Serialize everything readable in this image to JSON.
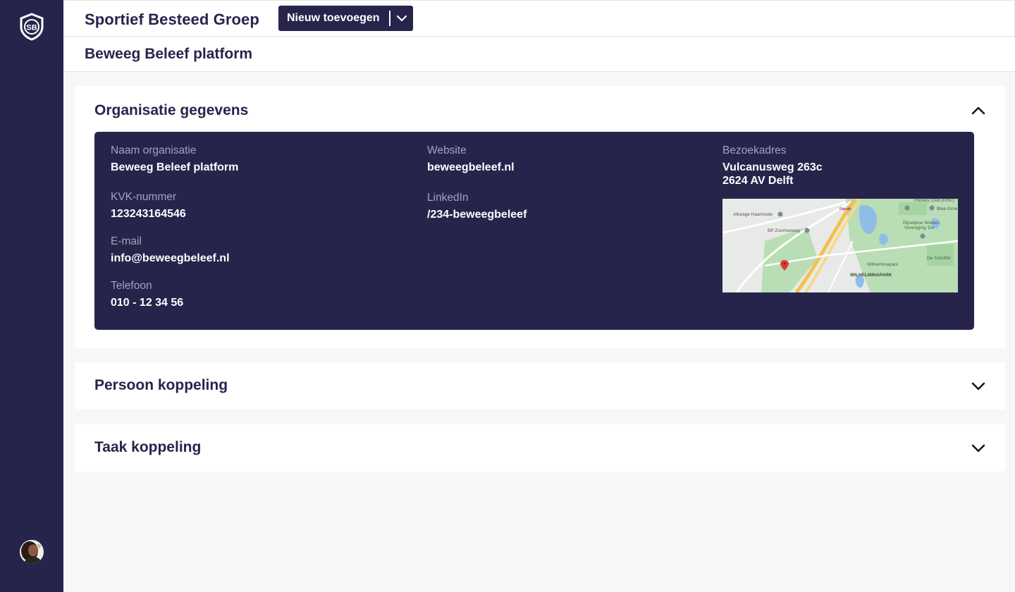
{
  "header": {
    "app_title": "Sportief Besteed Groep",
    "new_button_label": "Nieuw toevoegen",
    "page_title": "Beweeg Beleef platform"
  },
  "sidebar": {
    "logo_text": "SB",
    "logo_icon": "shield-logo-icon",
    "avatar_icon": "user-avatar"
  },
  "organisation": {
    "title": "Organisatie gegevens",
    "expanded": true,
    "fields": {
      "name_label": "Naam organisatie",
      "name_value": "Beweeg Beleef platform",
      "kvk_label": "KVK-nummer",
      "kvk_value": "123243164546",
      "email_label": "E-mail",
      "email_value": "info@beweegbeleef.nl",
      "phone_label": "Telefoon",
      "phone_value": "010 - 12 34 56",
      "website_label": "Website",
      "website_value": "beweegbeleef.nl",
      "linkedin_label": "LinkedIn",
      "linkedin_value": "/234-beweegbeleef",
      "address_label": "Bezoekadres",
      "address_line1": "Vulcanusweg 263c",
      "address_line2": "2624 AV Delft"
    },
    "map": {
      "labels": [
        "Hockey Club (RHC)",
        "Blue Groe",
        "Allurage Haarmode",
        "BP Zoomseweg",
        "Rijswijkse Wieken Vereniging De",
        "De Schoffel",
        "Wilhelminapark",
        "WILHELMINAPARK",
        "Rijswijk"
      ]
    }
  },
  "sections": [
    {
      "title": "Persoon koppeling",
      "expanded": false
    },
    {
      "title": "Taak koppeling",
      "expanded": false
    }
  ],
  "colors": {
    "primary": "#27244c",
    "muted_label": "#a3a2be",
    "background": "#f7f7f7"
  }
}
